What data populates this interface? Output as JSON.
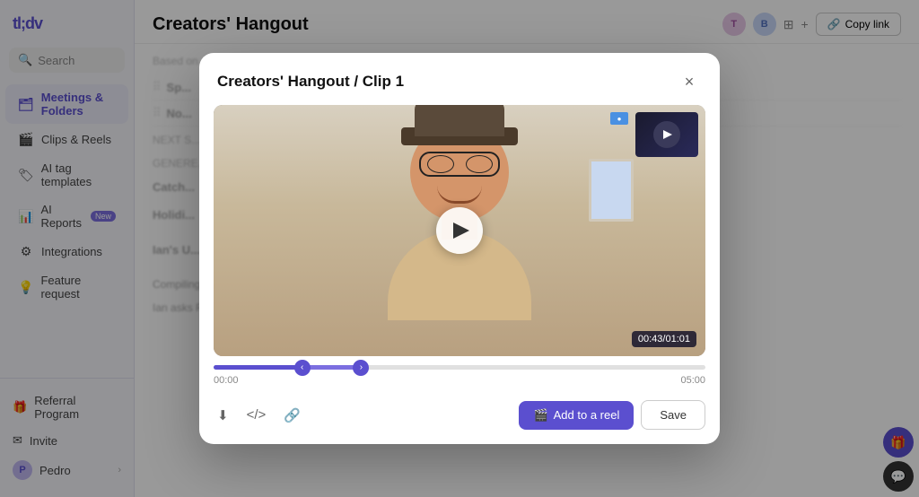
{
  "sidebar": {
    "logo": "tl;dv",
    "search": {
      "placeholder": "Search"
    },
    "items": [
      {
        "id": "meetings",
        "label": "Meetings & Folders",
        "icon": "🗂",
        "active": true
      },
      {
        "id": "clips",
        "label": "Clips & Reels",
        "icon": "🎬",
        "active": false
      },
      {
        "id": "aitags",
        "label": "AI tag templates",
        "icon": "🏷",
        "active": false
      },
      {
        "id": "aireports",
        "label": "AI Reports",
        "icon": "📊",
        "active": false,
        "badge": "New"
      },
      {
        "id": "integrations",
        "label": "Integrations",
        "icon": "⚙",
        "active": false
      },
      {
        "id": "feature",
        "label": "Feature request",
        "icon": "💡",
        "active": false
      }
    ],
    "bottom": [
      {
        "id": "referral",
        "label": "Referral Program",
        "icon": "🎁"
      },
      {
        "id": "invite",
        "label": "Invite",
        "icon": "✉"
      },
      {
        "id": "user",
        "label": "Pedro",
        "icon": "👤"
      }
    ]
  },
  "main": {
    "title": "Creators' Hangout",
    "copy_link_label": "Copy link"
  },
  "modal": {
    "title": "Creators' Hangout / Clip 1",
    "close_label": "×",
    "video": {
      "timestamp": "00:43/01:01",
      "duration_total": "05:00",
      "duration_current": "00:00"
    },
    "actions": {
      "download_tooltip": "Download",
      "embed_tooltip": "Embed",
      "link_tooltip": "Copy link",
      "add_reel_label": "Add to a reel",
      "save_label": "Save"
    }
  }
}
